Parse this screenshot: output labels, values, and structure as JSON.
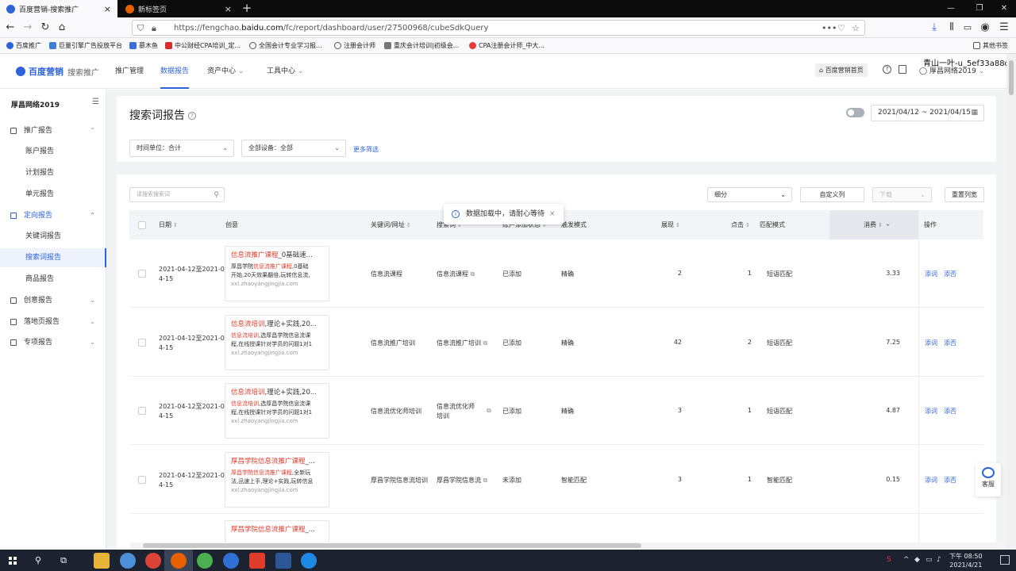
{
  "browser": {
    "tabs": [
      {
        "title": "百度营销-搜索推广",
        "active": true
      },
      {
        "title": "新标签页",
        "active": false
      }
    ],
    "new_tab": "+",
    "url_prefix": "https://fengchao.",
    "url_domain": "baidu.com",
    "url_suffix": "/fc/report/dashboard/user/27500968/cubeSdkQuery",
    "url_menu": "•••",
    "bookmarks": [
      "百度推广",
      "巨量引擎广告投放平台",
      "慕木鱼",
      "中公财经CPA培训_定...",
      "全国会计专业学习报...",
      "注册会计师",
      "重庆会计培训|初级会...",
      "CPA注册会计师_中大..."
    ],
    "other_bookmarks": "其他书签"
  },
  "header": {
    "logo": "百度营销",
    "logo_sub": "搜索推广",
    "nav": [
      "推广管理",
      "数据报告",
      "资产中心",
      "工具中心"
    ],
    "active_nav": "数据报告",
    "home_button": "百度营销首页",
    "account": "厚昌网络2019",
    "watermark": "青山一叶-u_5ef33a88db"
  },
  "sidebar": {
    "title": "厚昌网络2019",
    "groups": [
      {
        "label": "推广报告",
        "items": [
          "账户报告",
          "计划报告",
          "单元报告"
        ]
      },
      {
        "label": "定向报告",
        "items": [
          "关键词报告",
          "搜索词报告",
          "商品报告"
        ]
      },
      {
        "label": "创意报告"
      },
      {
        "label": "落地页报告"
      },
      {
        "label": "专项报告"
      }
    ],
    "active_item": "搜索词报告"
  },
  "report": {
    "title": "搜索词报告",
    "date_range": "2021/04/12 ~ 2021/04/15",
    "filter_time_unit": "时间单位：合计",
    "filter_device": "全部设备：全部",
    "more_filters": "更多筛选",
    "search_placeholder": "请搜索搜索词",
    "breakdown": "细分",
    "custom_columns": "自定义列",
    "download": "下载",
    "reset_col_width": "重置列宽",
    "toast": "数据加载中，请耐心等待"
  },
  "table": {
    "headers": [
      "日期",
      "创意",
      "关键词/网址",
      "搜索词",
      "账户添加状态",
      "触发模式",
      "展现",
      "点击",
      "匹配模式",
      "消费",
      "操作"
    ],
    "rows": [
      {
        "date_a": "2021-04-12至2021-0",
        "date_b": "4-15",
        "creative_title_hl": "信息流推广课程",
        "creative_title_rest": "_0基础速...",
        "creative_desc_a": "厚昌学院",
        "creative_desc_hl": "信息流推广课程",
        "creative_desc_b": ",0基础",
        "creative_desc_c": "开始,20天效果翻倍,玩转信息流,",
        "creative_url": "xxl.zhaoyangjingjia.com",
        "keyword": "信息流课程",
        "search_term": "信息流课程",
        "status": "已添加",
        "trigger": "精确",
        "impressions": "2",
        "clicks": "1",
        "match": "短语匹配",
        "cost": "3.33",
        "op_add_word": "添词",
        "op_add_neg": "添否"
      },
      {
        "date_a": "2021-04-12至2021-0",
        "date_b": "4-15",
        "creative_title_hl": "信息流培训",
        "creative_title_rest": ",理论+实践,20...",
        "creative_desc_a": "",
        "creative_desc_hl": "信息流培训",
        "creative_desc_b": ",选厚昌学院信息流课",
        "creative_desc_c": "程,在线授课针对学员的问题1对1",
        "creative_url": "xxl.zhaoyangjingjia.com",
        "keyword": "信息流推广培训",
        "search_term": "信息流推广培训",
        "status": "已添加",
        "trigger": "精确",
        "impressions": "42",
        "clicks": "2",
        "match": "短语匹配",
        "cost": "7.25",
        "op_add_word": "添词",
        "op_add_neg": "添否"
      },
      {
        "date_a": "2021-04-12至2021-0",
        "date_b": "4-15",
        "creative_title_hl": "信息流培训",
        "creative_title_rest": ",理论+实践,20...",
        "creative_desc_a": "",
        "creative_desc_hl": "信息流培训",
        "creative_desc_b": ",选厚昌学院信息流课",
        "creative_desc_c": "程,在线授课针对学员的问题1对1",
        "creative_url": "xxl.zhaoyangjingjia.com",
        "keyword": "信息流优化师培训",
        "search_term": "信息流优化师培训",
        "status": "已添加",
        "trigger": "精确",
        "impressions": "3",
        "clicks": "1",
        "match": "短语匹配",
        "cost": "4.87",
        "op_add_word": "添词",
        "op_add_neg": "添否"
      },
      {
        "date_a": "2021-04-12至2021-0",
        "date_b": "4-15",
        "creative_title_hl": "厚昌学院信息流推广课程",
        "creative_title_rest": "_...",
        "creative_desc_a": "",
        "creative_desc_hl": "厚昌学院信息流推广课程",
        "creative_desc_b": ",全新玩",
        "creative_desc_c": "法,迅速上手,理论+实践,玩转信息",
        "creative_url": "xxl.zhaoyangjingjia.com",
        "keyword": "厚昌学院信息流培训",
        "search_term": "厚昌学院信息流",
        "status": "未添加",
        "trigger": "智能匹配",
        "impressions": "3",
        "clicks": "1",
        "match": "智能匹配",
        "cost": "0.15",
        "op_add_word": "添词",
        "op_add_neg": "添否"
      },
      {
        "creative_title_hl": "厚昌学院信息流推广课程",
        "creative_title_rest": "_..."
      }
    ]
  },
  "service": "客服",
  "taskbar": {
    "time": "下午 08:50",
    "date": "2021/4/21"
  },
  "colors": {
    "accent": "#2d63d8",
    "highlight_red": "#e03c2c"
  }
}
